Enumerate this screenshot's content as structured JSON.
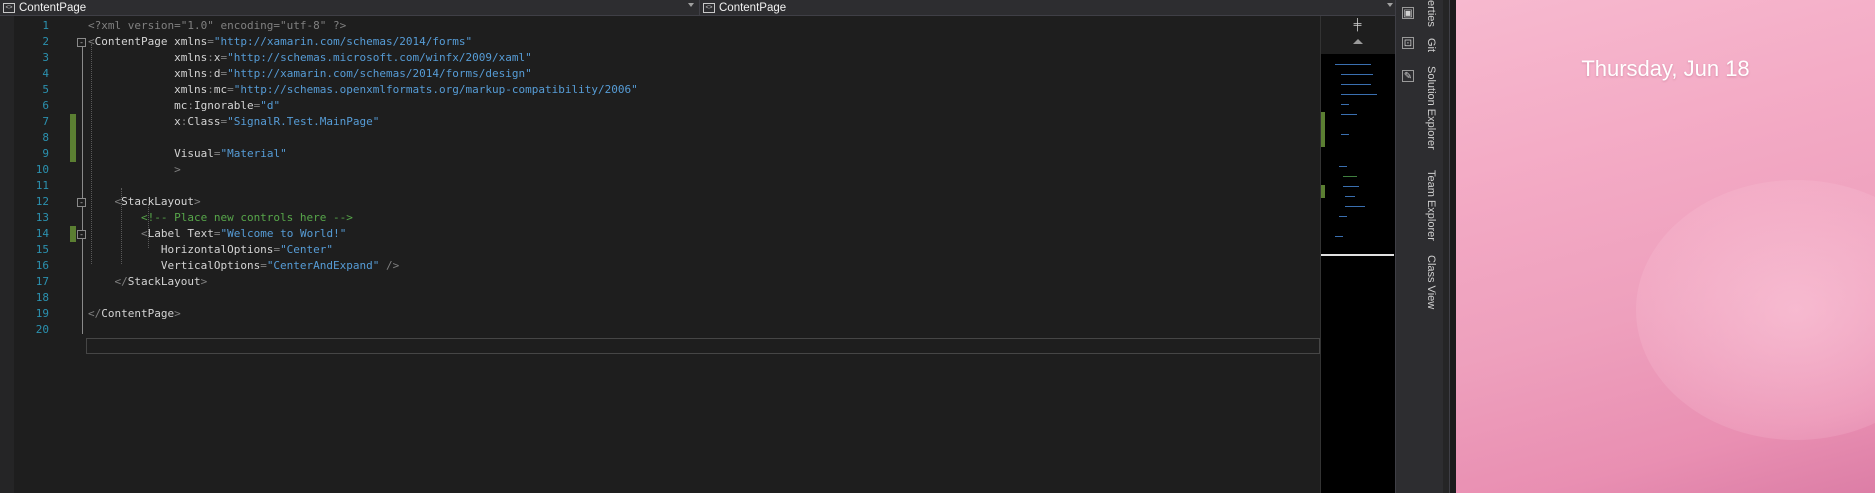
{
  "navbar": {
    "left_combo": "ContentPage",
    "right_combo": "ContentPage"
  },
  "editor": {
    "lines": [
      {
        "num": "1",
        "tokens": [
          {
            "t": "<?xml version=\"1.0\" encoding=\"utf-8\" ?>",
            "c": "t-punc"
          }
        ]
      },
      {
        "num": "2",
        "tokens": [
          {
            "t": "<",
            "c": "t-punc"
          },
          {
            "t": "ContentPage ",
            "c": "t-el"
          },
          {
            "t": "xmlns",
            "c": "t-attr2"
          },
          {
            "t": "=",
            "c": "t-punc"
          },
          {
            "t": "\"http://xamarin.com/schemas/2014/forms\"",
            "c": "t-val"
          }
        ]
      },
      {
        "num": "3",
        "tokens": [
          {
            "t": "             xmlns",
            "c": "t-attr2"
          },
          {
            "t": ":",
            "c": "t-punc"
          },
          {
            "t": "x",
            "c": "t-attr2"
          },
          {
            "t": "=",
            "c": "t-punc"
          },
          {
            "t": "\"http://schemas.microsoft.com/winfx/2009/xaml\"",
            "c": "t-val"
          }
        ]
      },
      {
        "num": "4",
        "tokens": [
          {
            "t": "             xmlns",
            "c": "t-attr2"
          },
          {
            "t": ":",
            "c": "t-punc"
          },
          {
            "t": "d",
            "c": "t-attr2"
          },
          {
            "t": "=",
            "c": "t-punc"
          },
          {
            "t": "\"http://xamarin.com/schemas/2014/forms/design\"",
            "c": "t-val"
          }
        ]
      },
      {
        "num": "5",
        "tokens": [
          {
            "t": "             xmlns",
            "c": "t-attr2"
          },
          {
            "t": ":",
            "c": "t-punc"
          },
          {
            "t": "mc",
            "c": "t-attr2"
          },
          {
            "t": "=",
            "c": "t-punc"
          },
          {
            "t": "\"http://schemas.openxmlformats.org/markup-compatibility/2006\"",
            "c": "t-val"
          }
        ]
      },
      {
        "num": "6",
        "tokens": [
          {
            "t": "             mc",
            "c": "t-attr2"
          },
          {
            "t": ":",
            "c": "t-punc"
          },
          {
            "t": "Ignorable",
            "c": "t-attr2"
          },
          {
            "t": "=",
            "c": "t-punc"
          },
          {
            "t": "\"d\"",
            "c": "t-val"
          }
        ]
      },
      {
        "num": "7",
        "tokens": [
          {
            "t": "             x",
            "c": "t-attr2"
          },
          {
            "t": ":",
            "c": "t-punc"
          },
          {
            "t": "Class",
            "c": "t-attr2"
          },
          {
            "t": "=",
            "c": "t-punc"
          },
          {
            "t": "\"SignalR.Test.MainPage\"",
            "c": "t-val"
          }
        ]
      },
      {
        "num": "8",
        "tokens": []
      },
      {
        "num": "9",
        "tokens": [
          {
            "t": "             Visual",
            "c": "t-attr2"
          },
          {
            "t": "=",
            "c": "t-punc"
          },
          {
            "t": "\"Material\"",
            "c": "t-val"
          }
        ]
      },
      {
        "num": "10",
        "tokens": [
          {
            "t": "             >",
            "c": "t-punc"
          }
        ]
      },
      {
        "num": "11",
        "tokens": []
      },
      {
        "num": "12",
        "tokens": [
          {
            "t": "    <",
            "c": "t-punc"
          },
          {
            "t": "StackLayout",
            "c": "t-el"
          },
          {
            "t": ">",
            "c": "t-punc"
          }
        ]
      },
      {
        "num": "13",
        "tokens": [
          {
            "t": "        <!-- Place new controls here -->",
            "c": "t-cmt"
          }
        ]
      },
      {
        "num": "14",
        "tokens": [
          {
            "t": "        <",
            "c": "t-punc"
          },
          {
            "t": "Label ",
            "c": "t-el"
          },
          {
            "t": "Text",
            "c": "t-attr2"
          },
          {
            "t": "=",
            "c": "t-punc"
          },
          {
            "t": "\"Welcome to World!\"",
            "c": "t-val"
          }
        ]
      },
      {
        "num": "15",
        "tokens": [
          {
            "t": "           HorizontalOptions",
            "c": "t-attr2"
          },
          {
            "t": "=",
            "c": "t-punc"
          },
          {
            "t": "\"Center\"",
            "c": "t-val"
          }
        ]
      },
      {
        "num": "16",
        "tokens": [
          {
            "t": "           VerticalOptions",
            "c": "t-attr2"
          },
          {
            "t": "=",
            "c": "t-punc"
          },
          {
            "t": "\"CenterAndExpand\"",
            "c": "t-val"
          },
          {
            "t": " />",
            "c": "t-punc"
          }
        ]
      },
      {
        "num": "17",
        "tokens": [
          {
            "t": "    </",
            "c": "t-punc"
          },
          {
            "t": "StackLayout",
            "c": "t-el"
          },
          {
            "t": ">",
            "c": "t-punc"
          }
        ]
      },
      {
        "num": "18",
        "tokens": []
      },
      {
        "num": "19",
        "tokens": [
          {
            "t": "</",
            "c": "t-punc"
          },
          {
            "t": "ContentPage",
            "c": "t-el"
          },
          {
            "t": ">",
            "c": "t-punc"
          }
        ]
      },
      {
        "num": "20",
        "tokens": []
      }
    ],
    "changed_lines": [
      "7",
      "8",
      "9",
      "14"
    ],
    "fold_lines": [
      "2",
      "12",
      "14"
    ]
  },
  "minimap": {
    "split_icon": "split-editor-icon",
    "scroll_up_icon": "scroll-up-arrow-icon"
  },
  "rail": {
    "icons": [
      "pin-icon",
      "preview-icon",
      "edit-icon"
    ]
  },
  "side_tabs": [
    "erties",
    "Git",
    "Solution Explorer",
    "Team Explorer",
    "Class View"
  ],
  "emulator": {
    "date": "Thursday, Jun 18"
  },
  "colors": {
    "editor_bg": "#1e1e1e",
    "line_number": "#2b91af",
    "xml_value": "#569cd6",
    "comment": "#57a64a",
    "change_bar": "#5b7f32",
    "emulator_pink": "#f3a9c4"
  }
}
